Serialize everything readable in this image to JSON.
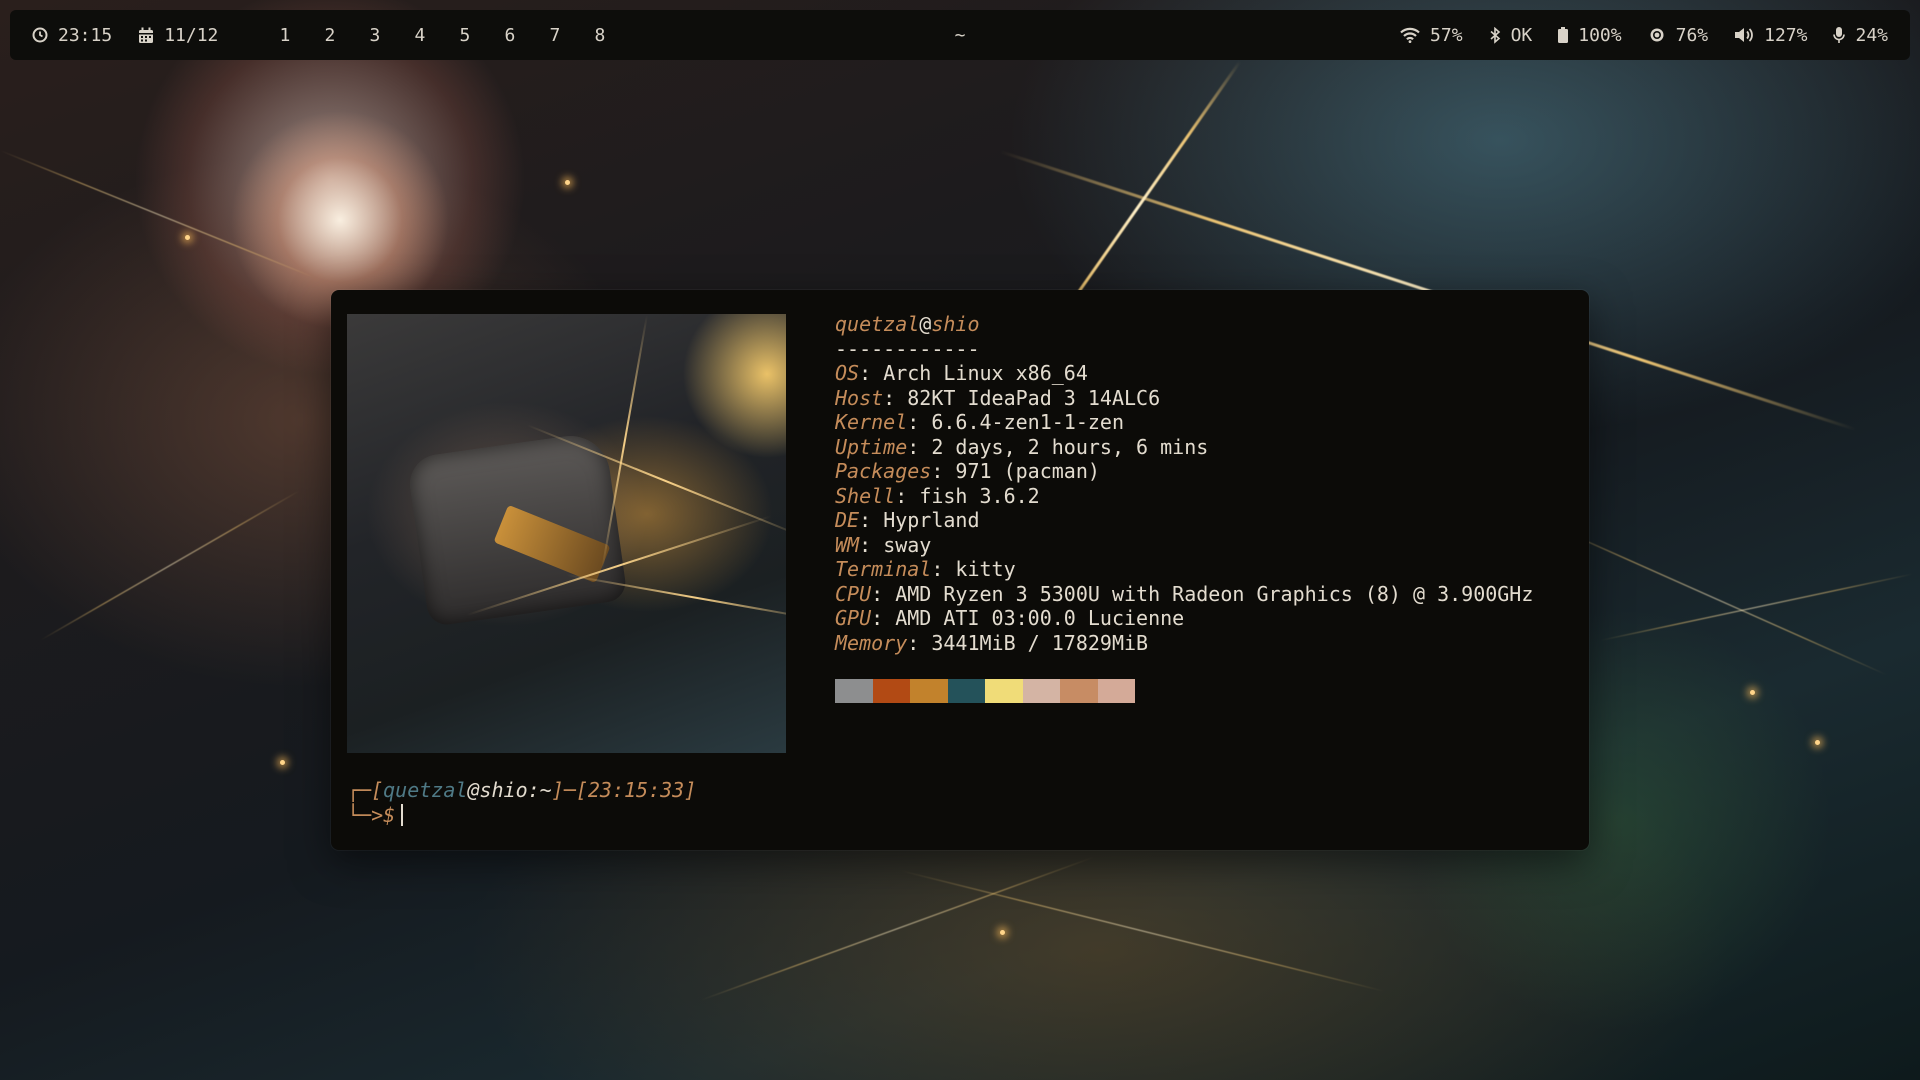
{
  "topbar": {
    "clock": "23:15",
    "date": "11/12",
    "workspaces": [
      "1",
      "2",
      "3",
      "4",
      "5",
      "6",
      "7",
      "8"
    ],
    "window_title": "~",
    "wifi": "57%",
    "bluetooth": "OK",
    "battery": "100%",
    "brightness": "76%",
    "volume": "127%",
    "microphone": "24%",
    "icons": {
      "clock": "clock-icon",
      "date": "calendar-icon",
      "wifi": "wifi-icon",
      "bluetooth": "bluetooth-icon",
      "battery": "battery-icon",
      "brightness": "brightness-icon",
      "volume": "volume-icon",
      "microphone": "microphone-icon"
    }
  },
  "terminal": {
    "fetch": {
      "user": "quetzal",
      "at": "@",
      "host": "shio",
      "separator": "------------",
      "rows": [
        {
          "key": "OS",
          "value": "Arch Linux x86_64"
        },
        {
          "key": "Host",
          "value": "82KT IdeaPad 3 14ALC6"
        },
        {
          "key": "Kernel",
          "value": "6.6.4-zen1-1-zen"
        },
        {
          "key": "Uptime",
          "value": "2 days, 2 hours, 6 mins"
        },
        {
          "key": "Packages",
          "value": "971 (pacman)"
        },
        {
          "key": "Shell",
          "value": "fish 3.6.2"
        },
        {
          "key": "DE",
          "value": "Hyprland"
        },
        {
          "key": "WM",
          "value": "sway"
        },
        {
          "key": "Terminal",
          "value": "kitty"
        },
        {
          "key": "CPU",
          "value": "AMD Ryzen 3 5300U with Radeon Graphics (8) @ 3.900GHz"
        },
        {
          "key": "GPU",
          "value": "AMD ATI 03:00.0 Lucienne"
        },
        {
          "key": "Memory",
          "value": "3441MiB / 17829MiB"
        }
      ],
      "palette": [
        "#8d8e8f",
        "#b24a14",
        "#c2822c",
        "#24525a",
        "#f0dc78",
        "#d4b4a4",
        "#c78c64",
        "#d4aa98"
      ]
    },
    "prompt": {
      "corner_top": "┌─",
      "open_bracket": "[",
      "user": "quetzal",
      "host": "@shio:~",
      "close_bracket": "]",
      "dash": "─",
      "time": "[23:15:33]",
      "corner_bottom": "└─",
      "symbol": ">$"
    }
  },
  "colors": {
    "bar_bg": "#0d0d0b",
    "terminal_bg": "#0c0b08",
    "accent": "#c58c5a",
    "prompt_user": "#4f7a86"
  }
}
